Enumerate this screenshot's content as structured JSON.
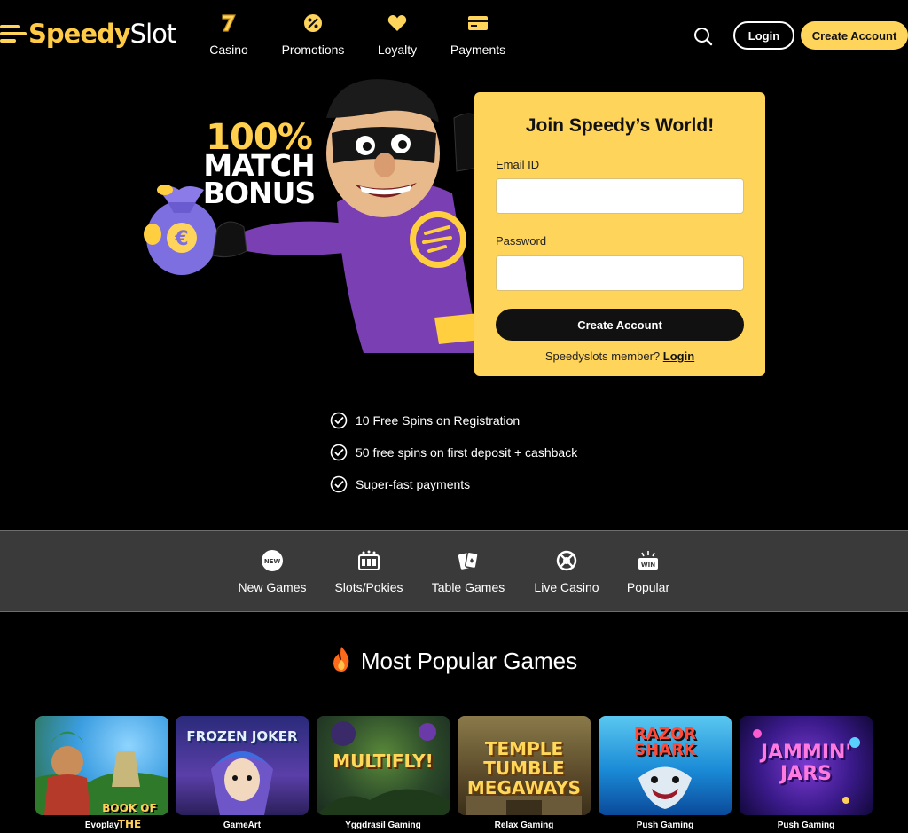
{
  "brand": {
    "logo_primary": "Speedy",
    "logo_secondary": "Slot",
    "accent_color": "#ffd45a"
  },
  "nav": [
    {
      "label": "Casino",
      "icon": "seven-icon"
    },
    {
      "label": "Promotions",
      "icon": "percent-icon"
    },
    {
      "label": "Loyalty",
      "icon": "heart-icon"
    },
    {
      "label": "Payments",
      "icon": "card-icon"
    }
  ],
  "header": {
    "login_label": "Login",
    "create_label": "Create Account",
    "search_icon": "search-icon"
  },
  "hero": {
    "bonus_line1": "100%",
    "bonus_line2": "MATCH",
    "bonus_line3": "BONUS"
  },
  "signup": {
    "title": "Join Speedy’s World!",
    "email_label": "Email ID",
    "email_value": "",
    "password_label": "Password",
    "password_value": "",
    "submit_label": "Create Account",
    "member_text": "Speedyslots member?",
    "member_link": "Login"
  },
  "perks": [
    "10 Free Spins on Registration",
    "50 free spins on first deposit + cashback",
    "Super-fast payments"
  ],
  "categories": [
    {
      "label": "New Games",
      "icon": "new-badge-icon"
    },
    {
      "label": "Slots/Pokies",
      "icon": "slot-machine-icon"
    },
    {
      "label": "Table Games",
      "icon": "cards-icon"
    },
    {
      "label": "Live Casino",
      "icon": "chips-icon"
    },
    {
      "label": "Popular",
      "icon": "win-icon"
    }
  ],
  "popular": {
    "title": "Most Popular Games",
    "icon": "fire-icon"
  },
  "games": [
    {
      "name": "BOOK OF THE PRIESTESS",
      "provider": "Evoplay"
    },
    {
      "name": "FROZEN JOKER",
      "provider": "GameArt"
    },
    {
      "name": "MULTIFLY!",
      "provider": "Yggdrasil Gaming"
    },
    {
      "name": "TEMPLE TUMBLE MEGAWAYS",
      "provider": "Relax Gaming"
    },
    {
      "name": "RAZOR SHARK",
      "provider": "Push Gaming"
    },
    {
      "name": "JAMMIN' JARS",
      "provider": "Push Gaming"
    }
  ]
}
